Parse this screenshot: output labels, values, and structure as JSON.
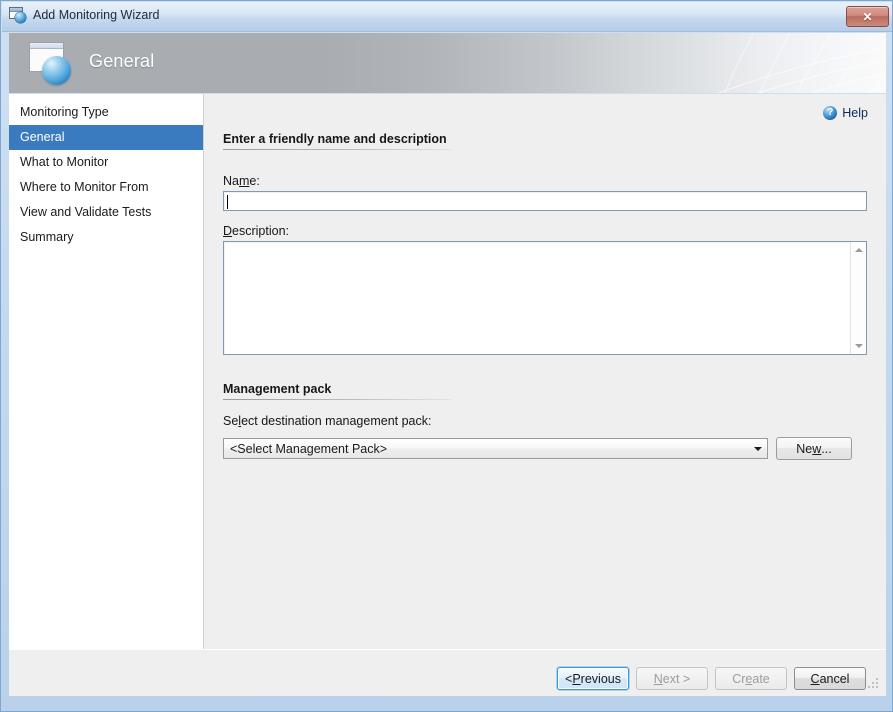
{
  "window": {
    "title": "Add Monitoring Wizard",
    "icon": "window-sphere-icon",
    "close_label": "✕"
  },
  "banner": {
    "title": "General",
    "icon": "document-sphere-icon"
  },
  "sidebar": {
    "items": [
      {
        "label": "Monitoring Type",
        "selected": false
      },
      {
        "label": "General",
        "selected": true
      },
      {
        "label": "What to Monitor",
        "selected": false
      },
      {
        "label": "Where to Monitor From",
        "selected": false
      },
      {
        "label": "View and Validate Tests",
        "selected": false
      },
      {
        "label": "Summary",
        "selected": false
      }
    ]
  },
  "content": {
    "help": {
      "label": "Help",
      "icon": "help-question-icon"
    },
    "section_name": {
      "heading": "Enter a friendly name and description",
      "name_label_pre": "Na",
      "name_label_accel": "m",
      "name_label_post": "e:",
      "name_value": "",
      "desc_label_accel": "D",
      "desc_label_post": "escription:",
      "desc_value": ""
    },
    "section_mp": {
      "heading": "Management pack",
      "select_label_pre": "Se",
      "select_label_accel": "l",
      "select_label_post": "ect destination management pack:",
      "combo_value": "<Select Management Pack>",
      "new_button_pre": "Ne",
      "new_button_accel": "w",
      "new_button_post": "..."
    }
  },
  "footer": {
    "buttons": [
      {
        "pre": "< ",
        "accel": "P",
        "post": "revious",
        "state": "focused"
      },
      {
        "pre": "",
        "accel": "N",
        "post": "ext >",
        "state": "disabled"
      },
      {
        "pre": "Cr",
        "accel": "e",
        "post": "ate",
        "state": "disabled"
      },
      {
        "pre": "",
        "accel": "C",
        "post": "ancel",
        "state": "enabled"
      }
    ]
  },
  "colors": {
    "accent": "#3a7bbf",
    "window_frame": "#b9d1ea",
    "content_bg": "#efeff0",
    "close_button": "#c98b7d"
  }
}
